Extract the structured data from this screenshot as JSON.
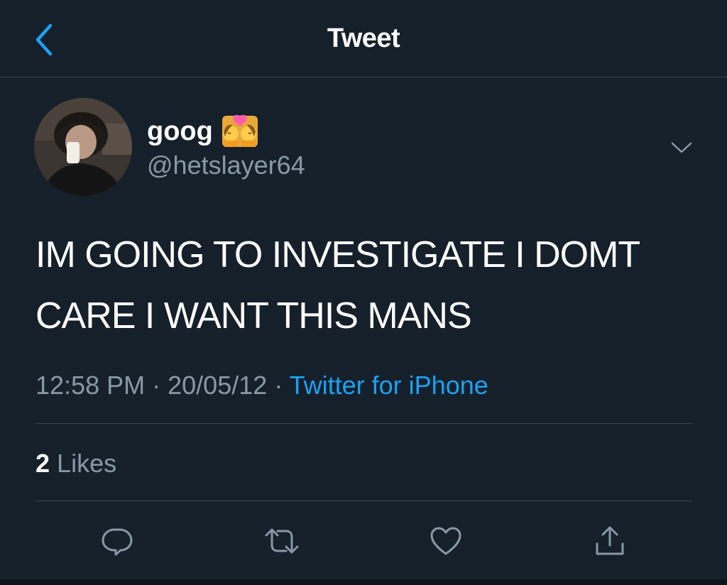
{
  "header": {
    "title": "Tweet",
    "back_icon": "chevron-left-icon"
  },
  "colors": {
    "background": "#15202b",
    "accent": "#1da1f2",
    "secondary_text": "#8899a6",
    "divider": "#38444d"
  },
  "author": {
    "display_name": "goog",
    "name_emoji": "kiss-woman-woman-emoji",
    "handle": "@hetslayer64",
    "avatar": "profile-photo"
  },
  "tweet": {
    "text": "IM GOING TO INVESTIGATE I DOMT CARE I WANT THIS MANS",
    "time": "12:58 PM",
    "separator": "·",
    "date": "20/05/12",
    "source": "Twitter for iPhone"
  },
  "stats": {
    "likes_count": "2",
    "likes_label": "Likes"
  },
  "actions": [
    {
      "name": "reply",
      "icon": "reply-icon"
    },
    {
      "name": "retweet",
      "icon": "retweet-icon"
    },
    {
      "name": "like",
      "icon": "heart-icon"
    },
    {
      "name": "share",
      "icon": "share-icon"
    }
  ]
}
